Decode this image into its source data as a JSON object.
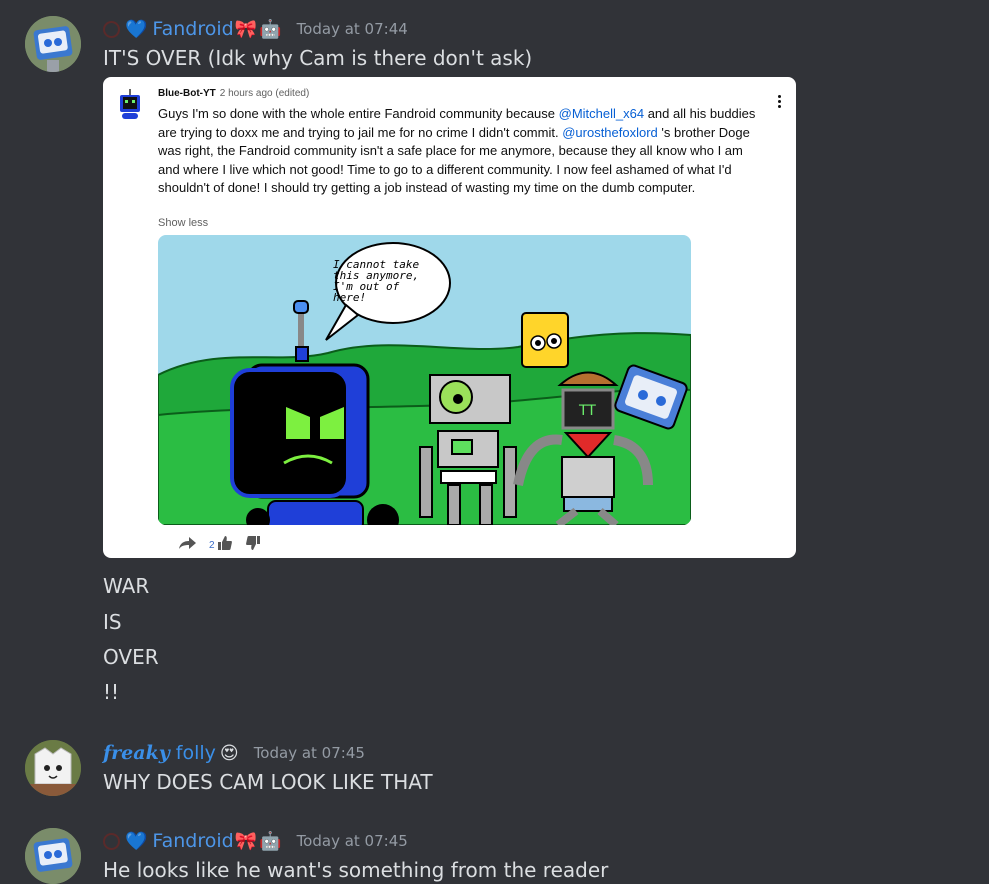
{
  "messages": [
    {
      "username": "Fandroid",
      "timestamp": "Today at 07:44",
      "text": "IT'S OVER (Idk why Cam is there don't ask)",
      "embed": {
        "author": "Blue-Bot-YT",
        "meta": "2 hours ago (edited)",
        "text_1": "Guys I'm so done with the whole entire Fandroid community because ",
        "mention_1": "@Mitchell_x64",
        "text_2": "  and all his buddies are trying to doxx me and trying to jail me for no crime I didn't commit. ",
        "mention_2": "@urosthefoxlord",
        "text_3": " 's brother Doge was right, the Fandroid community isn't a safe place for me anymore, because they all know who I am and where I live which not good! Time to go to a different community. I now feel ashamed of what I'd shouldn't of done! I should try getting a job instead of wasting my time on the dumb computer.",
        "show_less": "Show less",
        "like_count": "2",
        "comic_speech": [
          "I cannot take",
          "this anymore,",
          "I'm out of",
          "here!"
        ]
      },
      "followups": [
        "WAR",
        "IS",
        "OVER",
        "!!"
      ]
    },
    {
      "username": "freaky",
      "username_2": "folly",
      "timestamp": "Today at 07:45",
      "text": "WHY DOES CAM LOOK LIKE THAT"
    },
    {
      "username": "Fandroid",
      "timestamp": "Today at 07:45",
      "text": "He looks like he want's something from the reader"
    }
  ],
  "colors": {
    "background": "#313338",
    "fandroid_name": "#4d96e8",
    "folly_name": "#3a8fe8",
    "timestamp": "#949ba4"
  }
}
